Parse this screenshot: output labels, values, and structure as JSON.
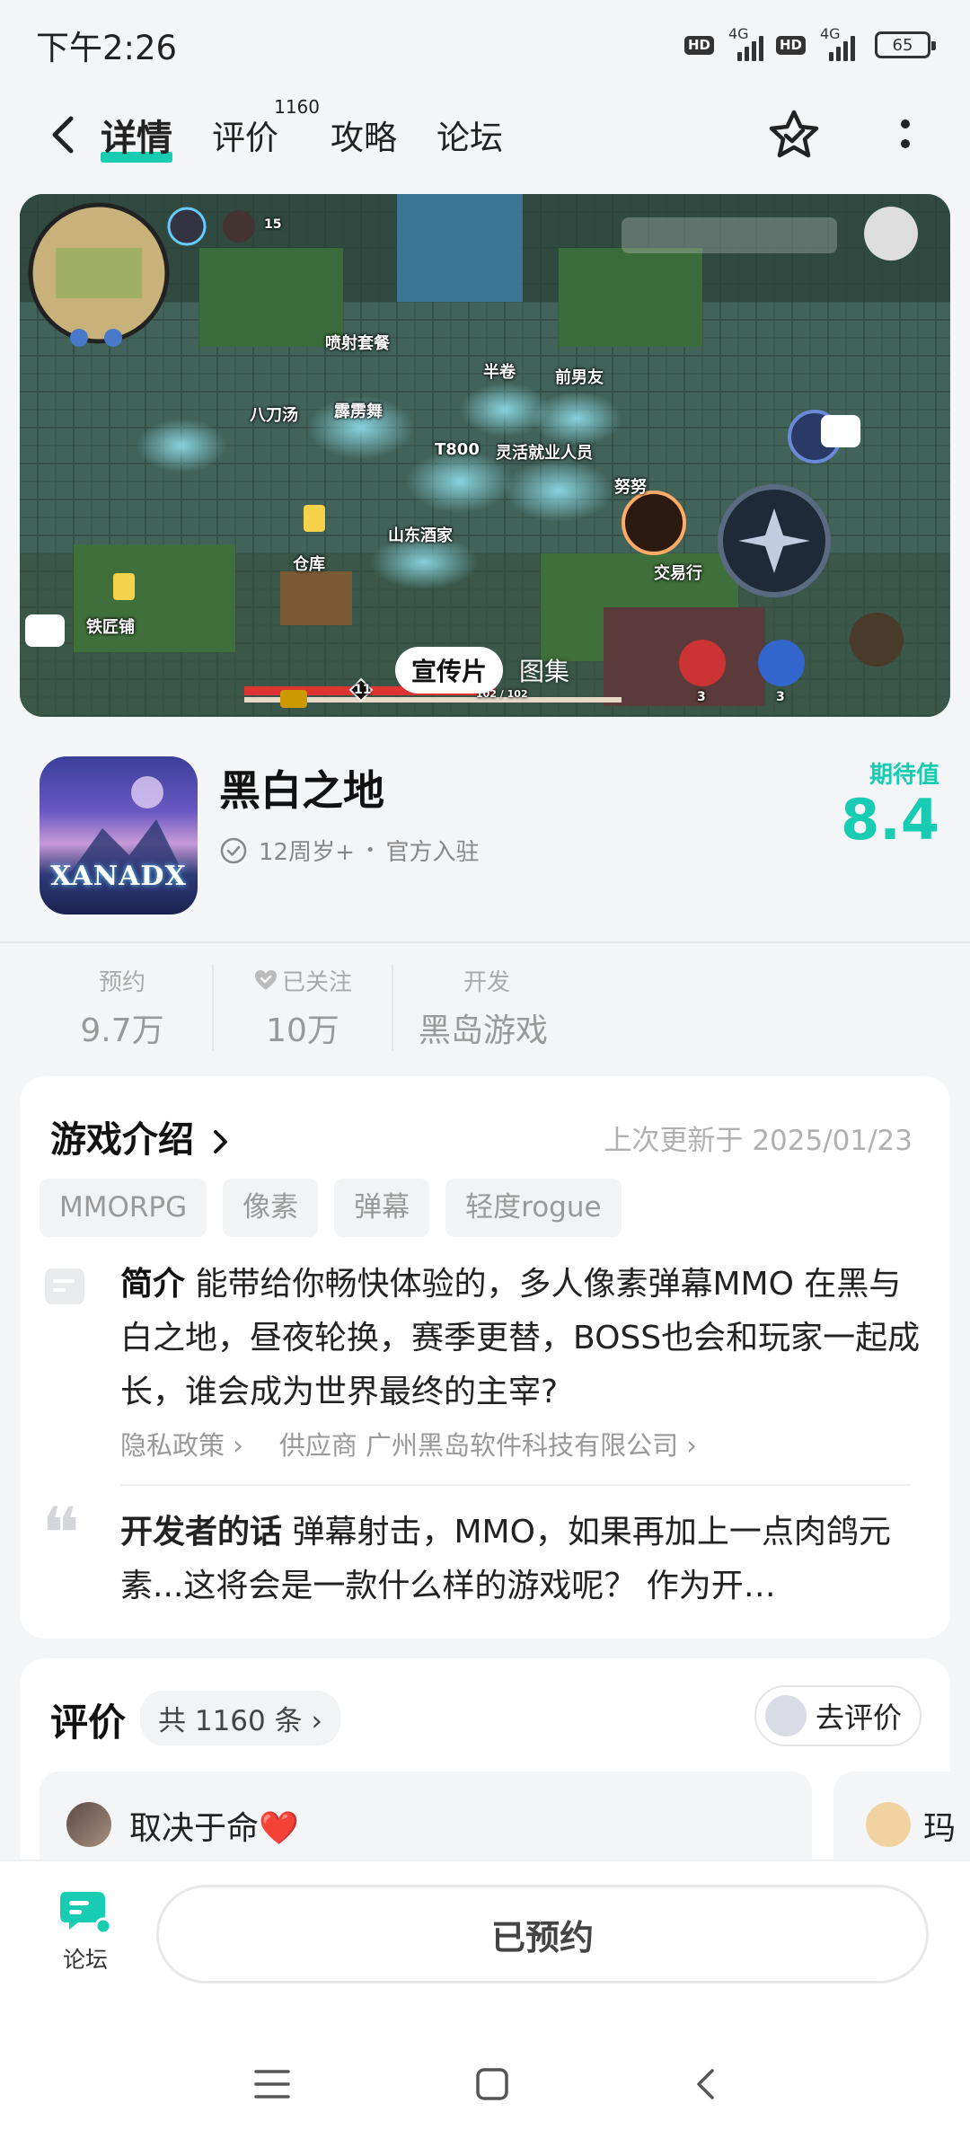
{
  "status_bar": {
    "time": "下午2:26",
    "hd1": "HD",
    "net1": "4G",
    "hd2": "HD",
    "net2": "4G",
    "battery": "65"
  },
  "nav": {
    "tabs": [
      {
        "label": "详情",
        "active": true
      },
      {
        "label": "评价",
        "count": "1160"
      },
      {
        "label": "攻略"
      },
      {
        "label": "论坛"
      }
    ],
    "accent_color": "#18cbb3"
  },
  "hero": {
    "labels": [
      "喷射套餐",
      "八刀汤",
      "霹雳舞",
      "半卷",
      "前男友",
      "T800",
      "灵活就业人员",
      "努努",
      "山东酒家",
      "仓库",
      "交易行",
      "铁匠铺"
    ],
    "minimap_count": "15",
    "hud_level": "11",
    "hud_hp": "102 / 102",
    "potion_count_1": "3",
    "potion_count_2": "3",
    "media_active": "宣传片",
    "media_other": "图集"
  },
  "app": {
    "name": "黑白之地",
    "icon_text": "XANADX",
    "age": "12周岁+",
    "dot": "•",
    "badge": "官方入驻",
    "score_label": "期待值",
    "score": "8.4"
  },
  "stats": [
    {
      "label": "预约",
      "value": "9.7万"
    },
    {
      "label": "已关注",
      "value": "10万"
    },
    {
      "label": "开发",
      "value": "黑岛游戏"
    }
  ],
  "intro": {
    "title": "游戏介绍",
    "updated": "上次更新于 2025/01/23",
    "tags": [
      "MMORPG",
      "像素",
      "弹幕",
      "轻度rogue"
    ],
    "summary_label": "简介",
    "summary": "能带给你畅快体验的，多人像素弹幕MMO 在黑与白之地，昼夜轮换，赛季更替，BOSS也会和玩家一起成长，谁会成为世界最终的主宰?",
    "privacy": "隐私政策",
    "supplier": "供应商 广州黑岛软件科技有限公司",
    "dev_label": "开发者的话",
    "dev_words": "弹幕射击，MMO，如果再加上一点肉鸽元素...这将会是一款什么样的游戏呢？ 作为开…"
  },
  "reviews": {
    "title": "评价",
    "count": "共 1160 条",
    "go_label": "去评价",
    "items": [
      {
        "user": "取决于命❤️"
      },
      {
        "user": "玛"
      }
    ]
  },
  "bottom": {
    "forum_label": "论坛",
    "reserved_label": "已预约"
  }
}
